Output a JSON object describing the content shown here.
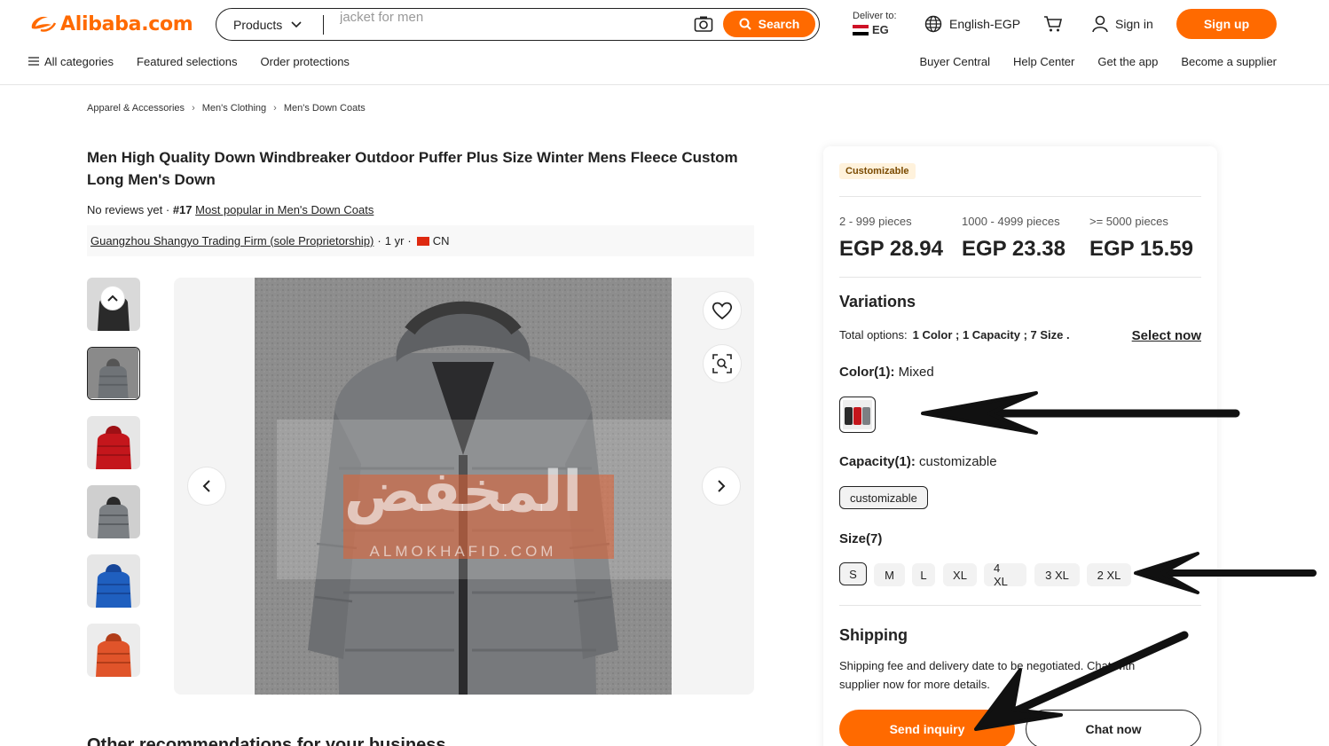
{
  "header": {
    "logo_text": "Alibaba.com",
    "search_category": "Products",
    "search_value": "jacket for men",
    "search_button": "Search",
    "deliver_label": "Deliver to:",
    "deliver_country": "EG",
    "language": "English-EGP",
    "sign_in": "Sign in",
    "sign_up": "Sign up"
  },
  "subnav": {
    "left": [
      "All categories",
      "Featured selections",
      "Order protections"
    ],
    "right": [
      "Buyer Central",
      "Help Center",
      "Get the app",
      "Become a supplier"
    ]
  },
  "breadcrumb": [
    "Apparel & Accessories",
    "Men's Clothing",
    "Men's Down Coats"
  ],
  "product": {
    "title": "Men High Quality Down Windbreaker Outdoor Puffer Plus Size Winter Mens Fleece Custom Long Men's Down",
    "reviews": "No reviews yet",
    "rank": "#17",
    "rank_link": "Most popular in Men's Down Coats",
    "supplier_name": "Guangzhou Shangyo Trading Firm (sole Proprietorship)",
    "supplier_years": "1 yr",
    "supplier_country": "CN",
    "watermark_arabic": "المخفض",
    "watermark_latin": "ALMOKHAFID.COM"
  },
  "thumbnails": [
    {
      "name": "black",
      "color": "#2a2a2a"
    },
    {
      "name": "grey",
      "color": "#6f7377"
    },
    {
      "name": "red",
      "color": "#c4161c"
    },
    {
      "name": "grey-2",
      "color": "#7b7f83"
    },
    {
      "name": "blue",
      "color": "#1f5fbf"
    },
    {
      "name": "orange",
      "color": "#e0542a"
    }
  ],
  "panel": {
    "badge": "Customizable",
    "tiers": [
      {
        "qty": "2 - 999 pieces",
        "price": "EGP 28.94"
      },
      {
        "qty": "1000 - 4999 pieces",
        "price": "EGP 23.38"
      },
      {
        "qty": ">= 5000 pieces",
        "price": "EGP 15.59"
      }
    ],
    "variations_title": "Variations",
    "total_label": "Total options:",
    "total_value": "1 Color ; 1 Capacity ; 7 Size .",
    "select_now": "Select now",
    "color_label": "Color(1):",
    "color_value": "Mixed",
    "capacity_label": "Capacity(1):",
    "capacity_value": "customizable",
    "capacity_option": "customizable",
    "size_label": "Size(7)",
    "sizes": [
      "S",
      "M",
      "L",
      "XL",
      "4 XL",
      "3 XL",
      "2 XL"
    ],
    "shipping_title": "Shipping",
    "shipping_text": "Shipping fee and delivery date to be negotiated. Chat with supplier now for more details.",
    "send_inquiry": "Send inquiry",
    "chat_now": "Chat now"
  },
  "other_recommendations": "Other recommendations for your business",
  "colors": {
    "brand_orange": "#ff6a00",
    "text": "#222222"
  }
}
